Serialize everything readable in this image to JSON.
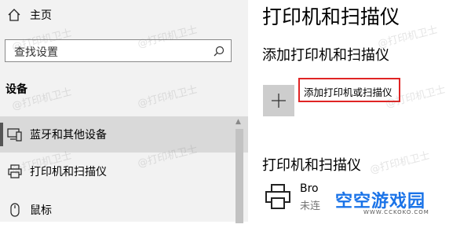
{
  "sidebar": {
    "home_label": "主页",
    "search_placeholder": "查找设置",
    "section_heading": "设备",
    "items": [
      {
        "label": "蓝牙和其他设备"
      },
      {
        "label": "打印机和扫描仪"
      },
      {
        "label": "鼠标"
      }
    ]
  },
  "main": {
    "title": "打印机和扫描仪",
    "add_section_title": "添加打印机和扫描仪",
    "add_button_label": "添加打印机或扫描仪",
    "list_heading": "打印机和扫描仪",
    "devices": [
      {
        "name": "Bro",
        "status": "未连"
      }
    ]
  },
  "watermark": "@打印机卫士",
  "logo": {
    "text": "空空游戏园",
    "url": "WWW.CCKOKO.COM"
  },
  "colors": {
    "highlight_border": "#e02424",
    "logo_blue": "#1a73e8",
    "selected_bg": "#d9d9d9"
  }
}
